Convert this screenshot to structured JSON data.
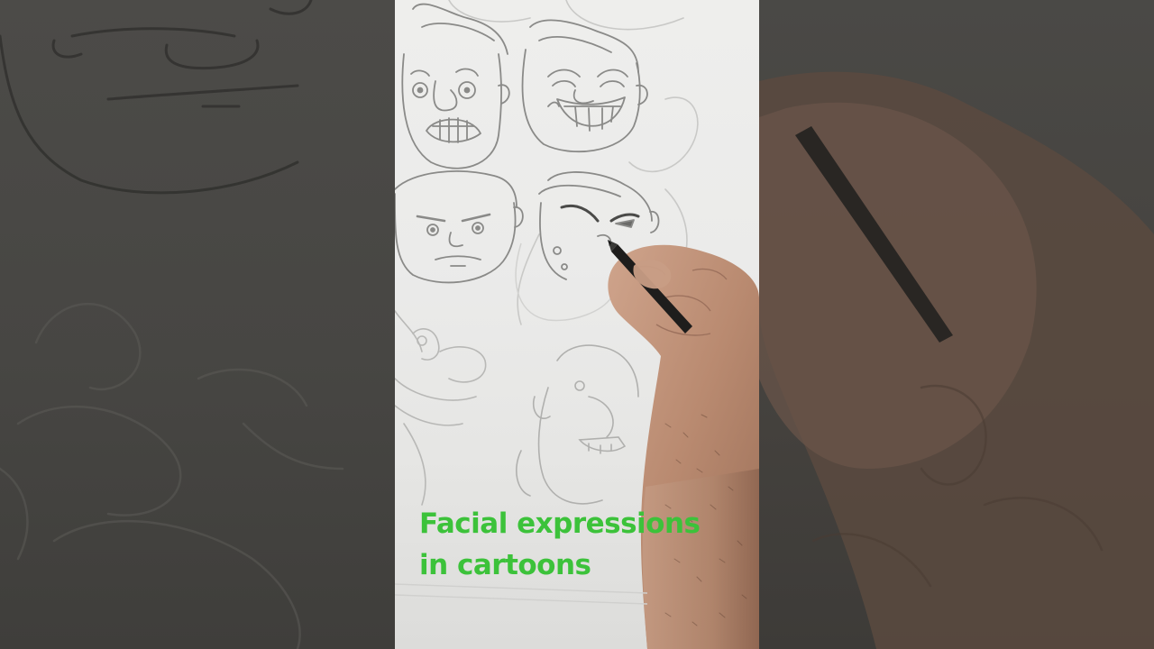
{
  "caption": {
    "line1": "Facial expressions",
    "line2": "in cartoons"
  },
  "colors": {
    "caption_green": "#3cc23a",
    "paper": "#ebebea",
    "side_band": "#474643",
    "pencil_stroke": "#8d8d8b"
  },
  "scene": {
    "subject": "hand drawing cartoon faces with a pencil",
    "faces": [
      "scared-face",
      "laughing-face",
      "frowning-face",
      "angry-face",
      "big-nose-face",
      "grinning-face"
    ]
  }
}
